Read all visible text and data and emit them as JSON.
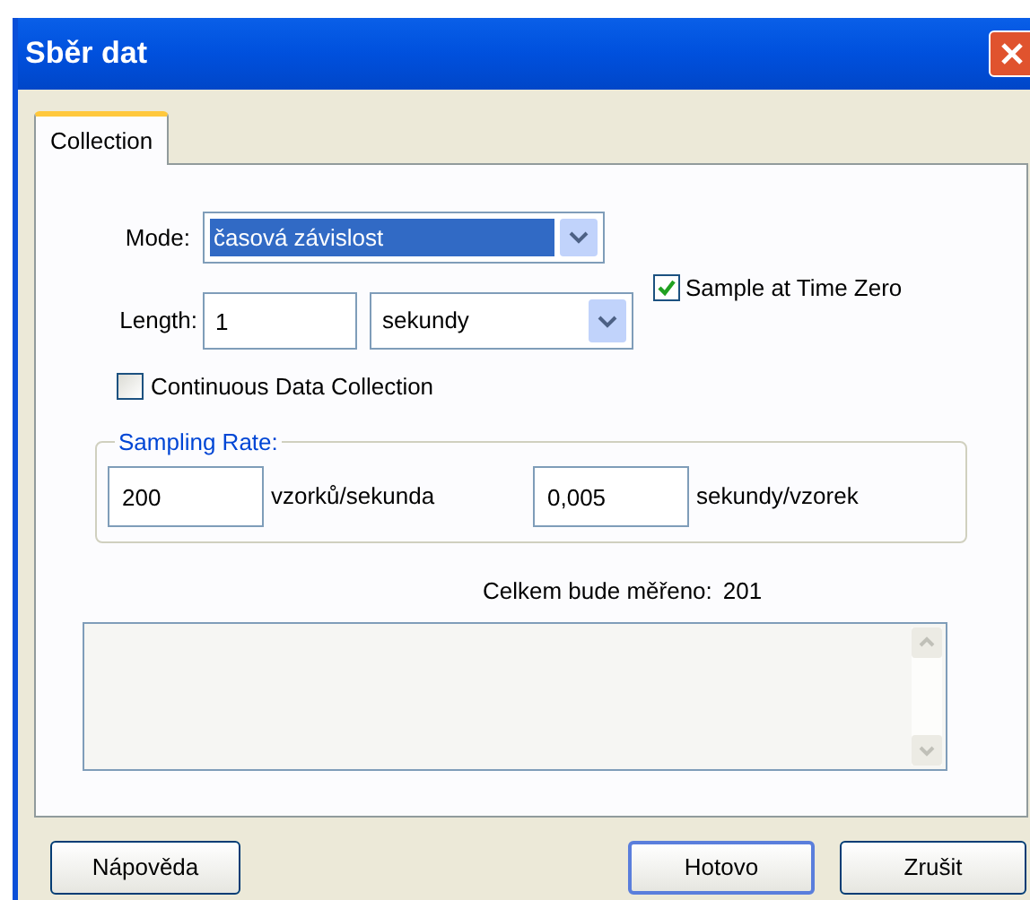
{
  "window": {
    "title": "Sběr dat"
  },
  "tabs": [
    {
      "label": "Collection",
      "selected": true
    }
  ],
  "mode": {
    "label": "Mode:",
    "value": "časová závislost"
  },
  "length": {
    "label": "Length:",
    "value": "1",
    "unit": "sekundy"
  },
  "sample_at_time_zero": {
    "label": "Sample at Time Zero",
    "checked": true
  },
  "continuous": {
    "label": "Continuous Data Collection",
    "checked": false
  },
  "sampling_rate": {
    "legend": "Sampling Rate:",
    "rate": "200",
    "rate_unit": "vzorků/sekunda",
    "interval": "0,005",
    "interval_unit": "sekundy/vzorek"
  },
  "total": {
    "label": "Celkem bude měřeno:",
    "value": "201"
  },
  "buttons": {
    "help": "Nápověda",
    "done": "Hotovo",
    "cancel": "Zrušit"
  }
}
